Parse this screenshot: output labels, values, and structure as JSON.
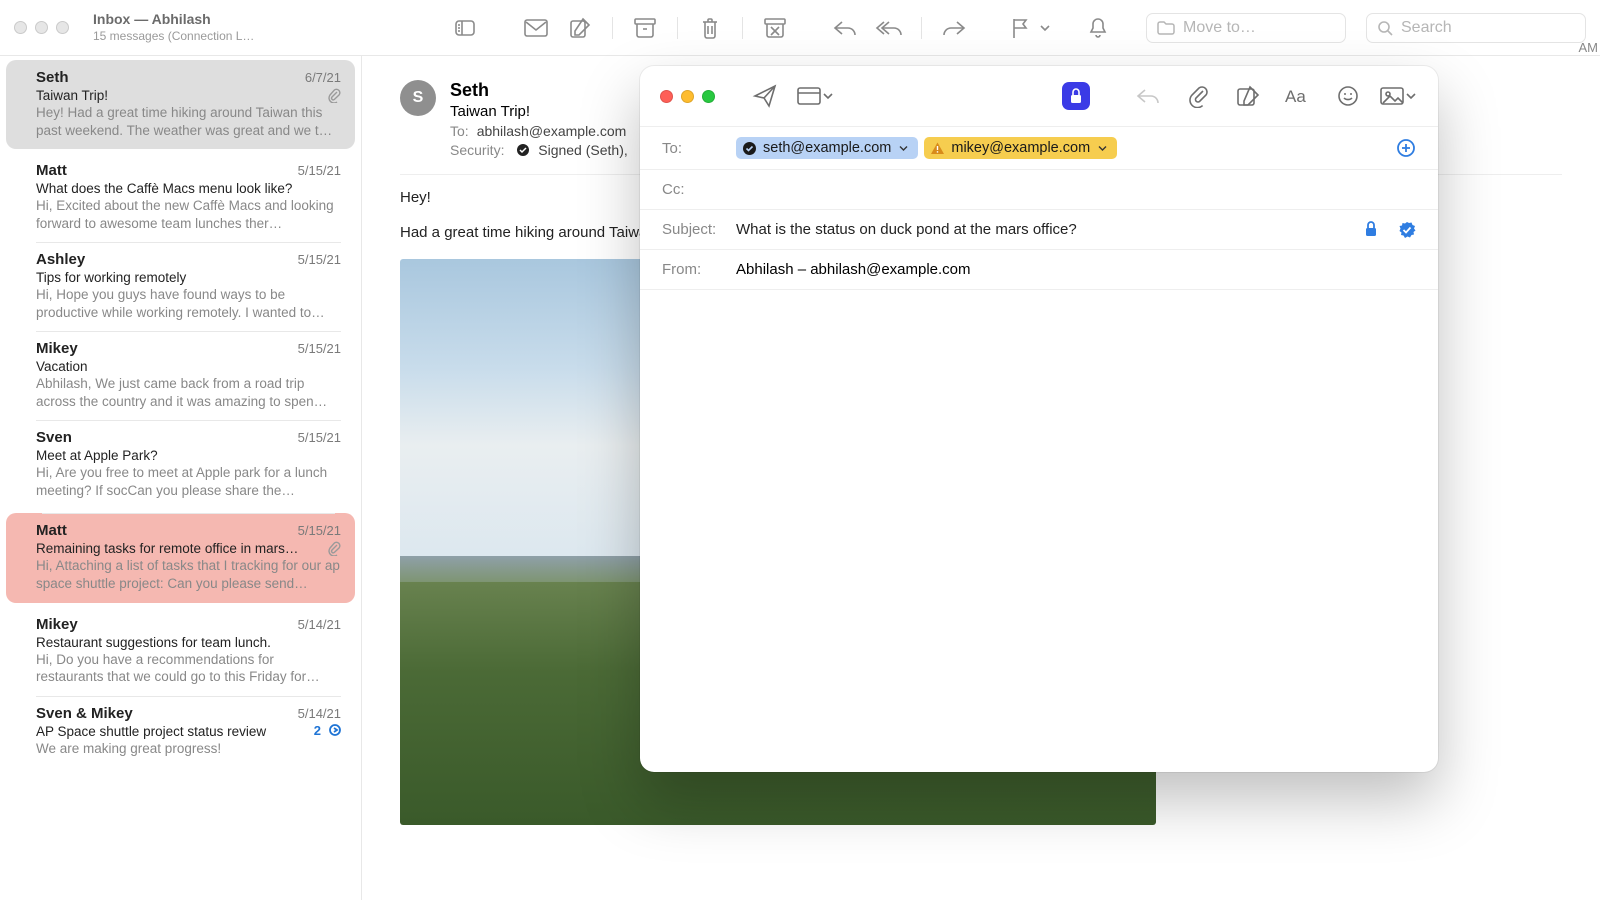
{
  "window": {
    "title": "Inbox — Abhilash",
    "subtitle": "15 messages (Connection L…"
  },
  "toolbar": {
    "move_to_placeholder": "Move to…",
    "search_placeholder": "Search"
  },
  "edge_text": "AM",
  "messages": [
    {
      "from": "Seth",
      "date": "6/7/21",
      "subject": "Taiwan Trip!",
      "preview": "Hey! Had a great time hiking around Taiwan this past weekend. The weather was great and we t…",
      "selected": true,
      "attachment": true
    },
    {
      "from": "Matt",
      "date": "5/15/21",
      "subject": "What does the Caffè Macs menu look like?",
      "preview": "Hi, Excited about the new Caffè Macs and looking forward to awesome team lunches ther…"
    },
    {
      "from": "Ashley",
      "date": "5/15/21",
      "subject": "Tips for working remotely",
      "preview": "Hi, Hope you guys have found ways to be productive while working remotely. I wanted to…"
    },
    {
      "from": "Mikey",
      "date": "5/15/21",
      "subject": "Vacation",
      "preview": "Abhilash, We just came back from a road trip across the country and it was amazing to spen…"
    },
    {
      "from": "Sven",
      "date": "5/15/21",
      "subject": "Meet at Apple Park?",
      "preview": "Hi, Are you free to meet at Apple park for a lunch meeting? If socCan you please share the…"
    },
    {
      "from": "Matt",
      "date": "5/15/21",
      "subject": "Remaining tasks for remote office in mars…",
      "preview": "Hi, Attaching a list of tasks that I tracking for our ap space shuttle project: Can you please send…",
      "flagged": true,
      "attachment": true
    },
    {
      "from": "Mikey",
      "date": "5/14/21",
      "subject": "Restaurant suggestions for team lunch.",
      "preview": "Hi, Do you have a recommendations for restaurants that we could go to this Friday for…"
    },
    {
      "from": "Sven & Mikey",
      "date": "5/14/21",
      "subject": "AP Space shuttle project status review",
      "preview": "We are making great progress!",
      "thread_count": "2"
    }
  ],
  "reader": {
    "avatar_initial": "S",
    "from": "Seth",
    "subject": "Taiwan Trip!",
    "to_label": "To:",
    "to_value": "abhilash@example.com",
    "security_label": "Security:",
    "security_value": "Signed (Seth),",
    "body_line1": "Hey!",
    "body_line2": "Had a great time hiking around Taiwan"
  },
  "compose": {
    "to_label": "To:",
    "cc_label": "Cc:",
    "subject_label": "Subject:",
    "from_label": "From:",
    "to_recipients": [
      {
        "email": "seth@example.com",
        "type": "verified"
      },
      {
        "email": "mikey@example.com",
        "type": "warning"
      }
    ],
    "subject_value": "What is the status on duck pond at the mars office?",
    "from_value": "Abhilash – abhilash@example.com"
  }
}
